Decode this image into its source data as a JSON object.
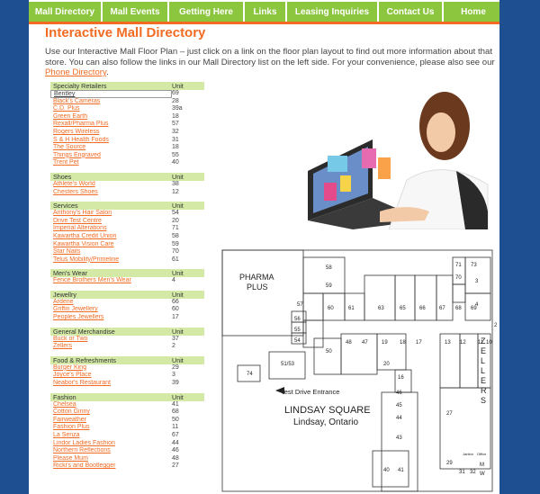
{
  "nav": [
    "Mall Directory",
    "Mall Events",
    "Getting Here",
    "Links",
    "Leasing Inquiries",
    "Contact Us",
    "Home"
  ],
  "title": "Interactive Mall Directory",
  "intro": {
    "text": "Use our Interactive Mall Floor Plan – just click on a link on the floor plan layout to find out more information about that store. You can also follow the links in our Mall Directory list on the left side. For your convenience, please also see our ",
    "link": "Phone Directory",
    "end": "."
  },
  "unit_header": "Unit",
  "sections": [
    {
      "name": "Specialty Retailers",
      "stores": [
        [
          "Bentley",
          "69"
        ],
        [
          "Black's Cameras",
          "28"
        ],
        [
          "C.D. Plus",
          "39a"
        ],
        [
          "Green Earth",
          "18"
        ],
        [
          "Rexall/Pharma Plus",
          "57"
        ],
        [
          "Rogers Wireless",
          "32"
        ],
        [
          "S & H Health Foods",
          "31"
        ],
        [
          "The Source",
          "18"
        ],
        [
          "Things Engraved",
          "55"
        ],
        [
          "Trent Pet",
          "40"
        ]
      ]
    },
    {
      "name": "Shoes",
      "stores": [
        [
          "Athlete's World",
          "38"
        ],
        [
          "Chesters Shoes",
          "12"
        ]
      ]
    },
    {
      "name": "Services",
      "stores": [
        [
          "Anthony's Hair Salon",
          "54"
        ],
        [
          "Drive Test Centre",
          "20"
        ],
        [
          "Imperial Alterations",
          "71"
        ],
        [
          "Kawartha Credit Union",
          "58"
        ],
        [
          "Kawartha Vision Care",
          "59"
        ],
        [
          "Star Nails",
          "70"
        ],
        [
          "Telus Mobility/Primeline",
          "61"
        ]
      ]
    },
    {
      "name": "Men's Wear",
      "stores": [
        [
          "Fence Brothers Men's Wear",
          "4"
        ]
      ]
    },
    {
      "name": "Jewellry",
      "stores": [
        [
          "Ardene",
          "66"
        ],
        [
          "Griffin Jewellery",
          "60"
        ],
        [
          "Peoples Jewellers",
          "17"
        ]
      ]
    },
    {
      "name": "General Merchandise",
      "stores": [
        [
          "Buck or Two",
          "37"
        ],
        [
          "Zellers",
          "2"
        ]
      ]
    },
    {
      "name": "Food & Refreshments",
      "stores": [
        [
          "Burger King",
          "29"
        ],
        [
          "Joyce's Place",
          "3"
        ],
        [
          "Neabor's Restaurant",
          "39"
        ]
      ]
    },
    {
      "name": "Fashion",
      "stores": [
        [
          "Chelsea",
          "41"
        ],
        [
          "Cotton Ginny",
          "68"
        ],
        [
          "Fairweather",
          "50"
        ],
        [
          "Fashion Plus",
          "11"
        ],
        [
          "La Senza",
          "67"
        ],
        [
          "Lindor Ladies Fashion",
          "44"
        ],
        [
          "Northern Reflections",
          "46"
        ],
        [
          "Please Mum",
          "48"
        ],
        [
          "Ricki's and Bootlegger",
          "27"
        ]
      ]
    }
  ],
  "plan": {
    "pharma": "PHARMA",
    "plus": "PLUS",
    "zellers": [
      "Z",
      "E",
      "L",
      "L",
      "E",
      "R",
      "S"
    ],
    "entrance": "Test Drive Entrance",
    "mall_name": "LINDSAY SQUARE",
    "mall_city": "Lindsay, Ontario",
    "janitor": "Janitor",
    "office": "Office",
    "m": "M",
    "w": "W",
    "units": [
      "58",
      "59",
      "60",
      "61",
      "63",
      "65",
      "66",
      "67",
      "68",
      "69",
      "71",
      "70",
      "73",
      "3",
      "4",
      "2",
      "57",
      "56",
      "55",
      "54",
      "50",
      "48",
      "47",
      "19",
      "18",
      "17",
      "13",
      "12",
      "11",
      "10",
      "51/53",
      "20",
      "16",
      "46",
      "45",
      "44",
      "43",
      "74",
      "27",
      "40",
      "41",
      "29",
      "31",
      "32"
    ]
  }
}
